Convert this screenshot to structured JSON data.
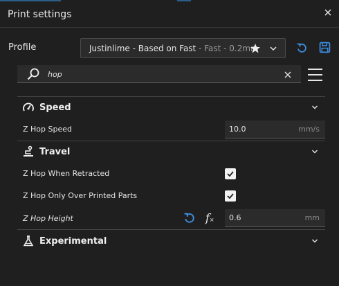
{
  "window": {
    "title": "Print settings"
  },
  "profile": {
    "label": "Profile",
    "selected_main": "Justinlime - Based on Fast",
    "selected_sub": " - Fast - 0.2mm"
  },
  "search": {
    "value": "hop"
  },
  "colors": {
    "accent": "#3d8ee0",
    "checkbox": "#f2f2f2"
  },
  "sections": {
    "speed": {
      "title": "Speed",
      "settings": {
        "z_hop_speed": {
          "label": "Z Hop Speed",
          "value": "10.0",
          "unit": "mm/s"
        }
      }
    },
    "travel": {
      "title": "Travel",
      "settings": {
        "z_hop_when_retracted": {
          "label": "Z Hop When Retracted",
          "checked": true
        },
        "z_hop_only_over_printed": {
          "label": "Z Hop Only Over Printed Parts",
          "checked": true
        },
        "z_hop_height": {
          "label": "Z Hop Height",
          "value": "0.6",
          "unit": "mm"
        }
      }
    },
    "experimental": {
      "title": "Experimental"
    }
  },
  "icons": {
    "close": "close-icon",
    "star": "star-icon",
    "chevron": "chevron-down-icon",
    "undo": "undo-icon",
    "save": "save-icon",
    "search": "search-icon",
    "menu": "hamburger-menu-icon",
    "speed": "speedometer-icon",
    "travel": "travel-icon",
    "experimental": "flask-icon",
    "formula": "formula-icon"
  }
}
